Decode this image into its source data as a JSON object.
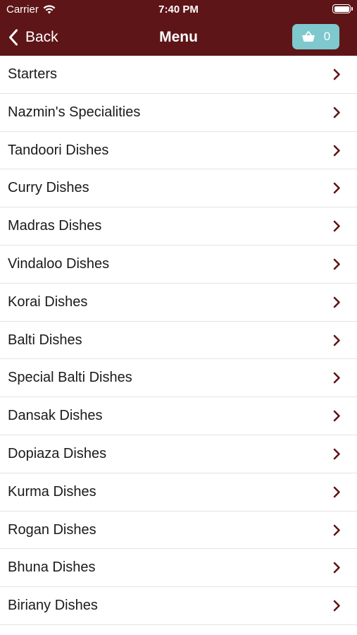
{
  "status_bar": {
    "carrier": "Carrier",
    "time": "7:40 PM",
    "wifi_icon": "wifi-icon",
    "battery_icon": "battery-icon"
  },
  "nav": {
    "back_label": "Back",
    "back_icon": "chevron-left-icon",
    "title": "Menu",
    "basket_icon": "basket-icon",
    "basket_count": "0"
  },
  "menu": {
    "items": [
      {
        "label": "Starters"
      },
      {
        "label": "Nazmin's Specialities"
      },
      {
        "label": "Tandoori Dishes"
      },
      {
        "label": "Curry Dishes"
      },
      {
        "label": "Madras Dishes"
      },
      {
        "label": "Vindaloo Dishes"
      },
      {
        "label": "Korai Dishes"
      },
      {
        "label": "Balti Dishes"
      },
      {
        "label": "Special Balti Dishes"
      },
      {
        "label": "Dansak Dishes"
      },
      {
        "label": "Dopiaza Dishes"
      },
      {
        "label": "Kurma Dishes"
      },
      {
        "label": "Rogan Dishes"
      },
      {
        "label": "Bhuna Dishes"
      },
      {
        "label": "Biriany Dishes"
      }
    ],
    "row_icon": "chevron-right-icon"
  },
  "colors": {
    "header_bg": "#5e1518",
    "basket_bg": "#7ec8ce",
    "chevron": "#5e1518",
    "divider": "#e3e3e3"
  }
}
